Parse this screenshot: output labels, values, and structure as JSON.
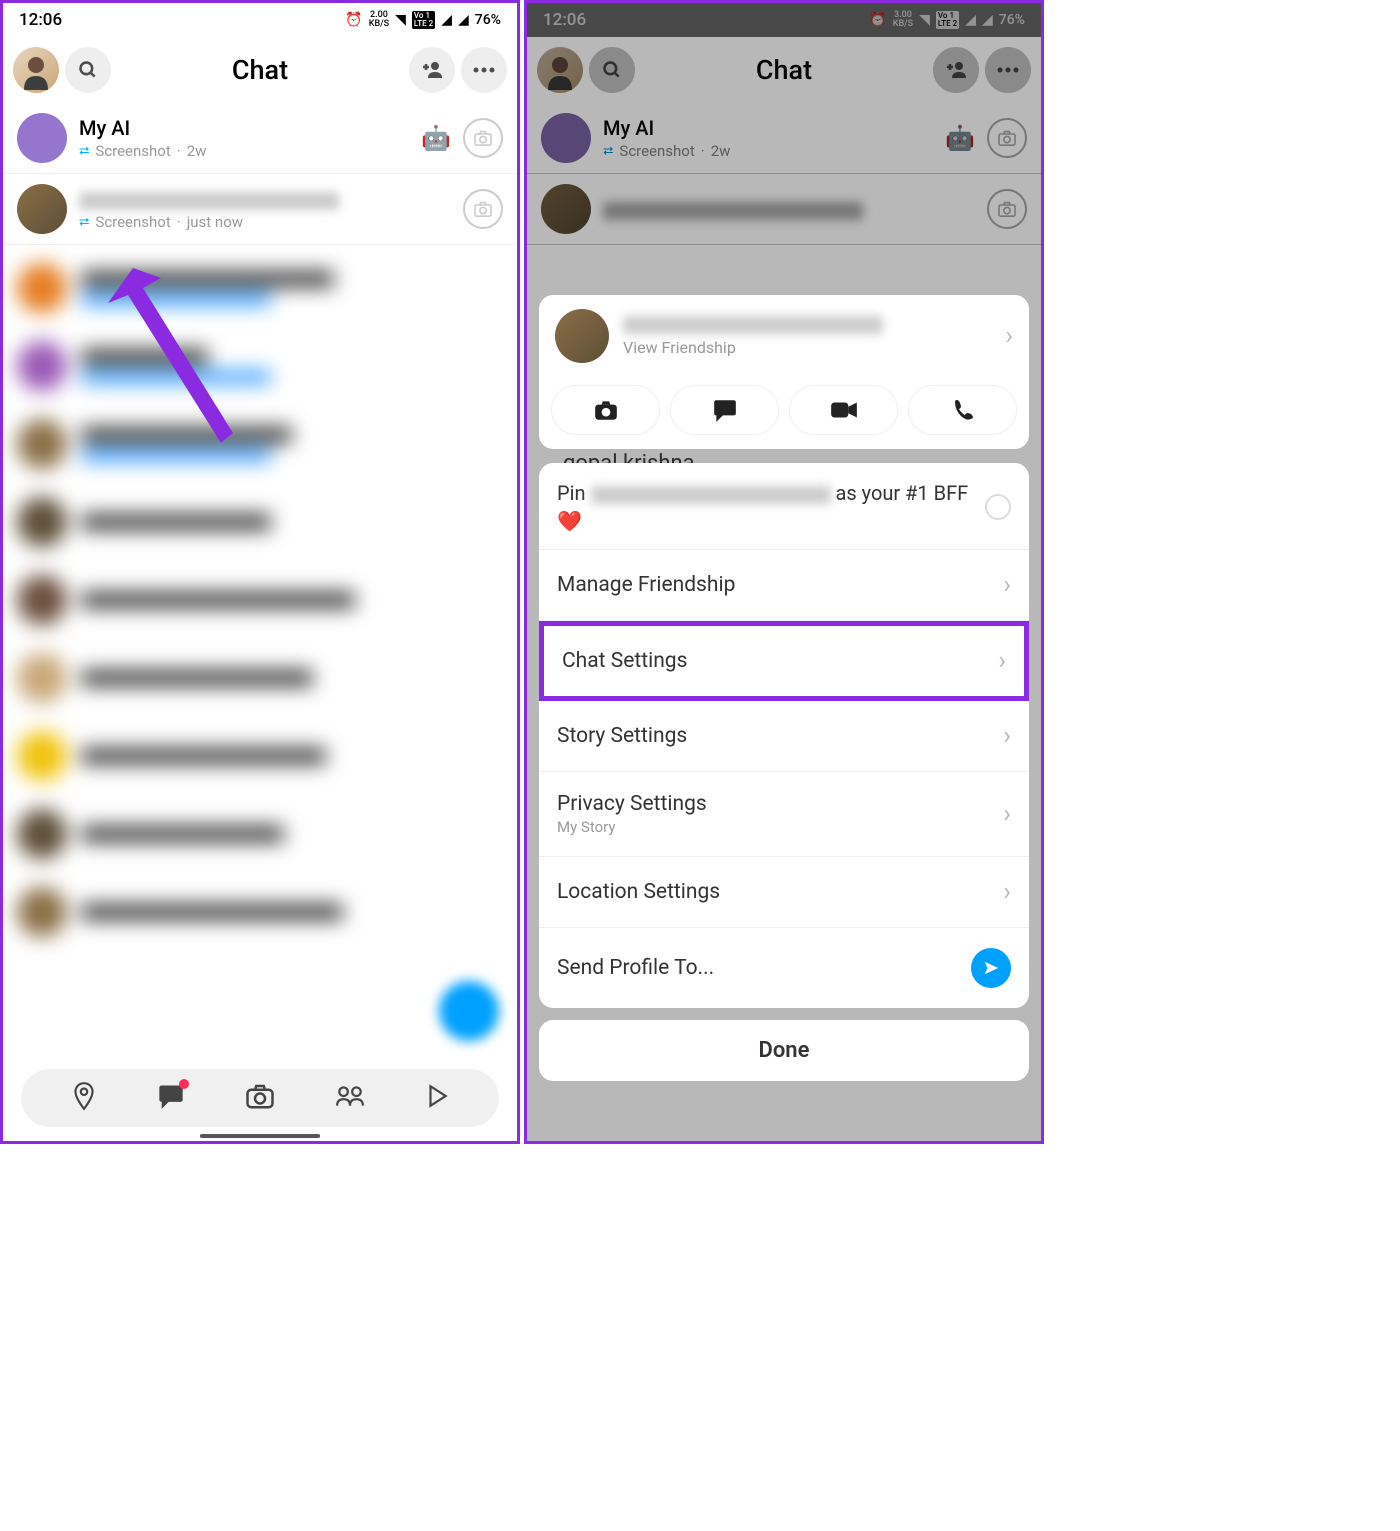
{
  "status": {
    "time": "12:06",
    "speed_l": "2.00",
    "speed_r": "3.00",
    "speed_unit": "KB/S",
    "lte": "LTE 2",
    "vo": "Vo",
    "battery": "76%"
  },
  "header": {
    "title": "Chat"
  },
  "chats": [
    {
      "name": "My AI",
      "status": "Screenshot",
      "time": "2w",
      "emoji": "🤖"
    },
    {
      "name": "",
      "status": "Screenshot",
      "time": "just now"
    }
  ],
  "peek_name": "gopal krishna",
  "sheet": {
    "view_friendship": "View Friendship",
    "pin_prefix": "Pin ",
    "pin_suffix": " as your #1 BFF ❤️",
    "manage": "Manage Friendship",
    "chat_settings": "Chat Settings",
    "story_settings": "Story Settings",
    "privacy": "Privacy Settings",
    "privacy_sub": "My Story",
    "location": "Location Settings",
    "send_profile": "Send Profile To...",
    "done": "Done"
  }
}
